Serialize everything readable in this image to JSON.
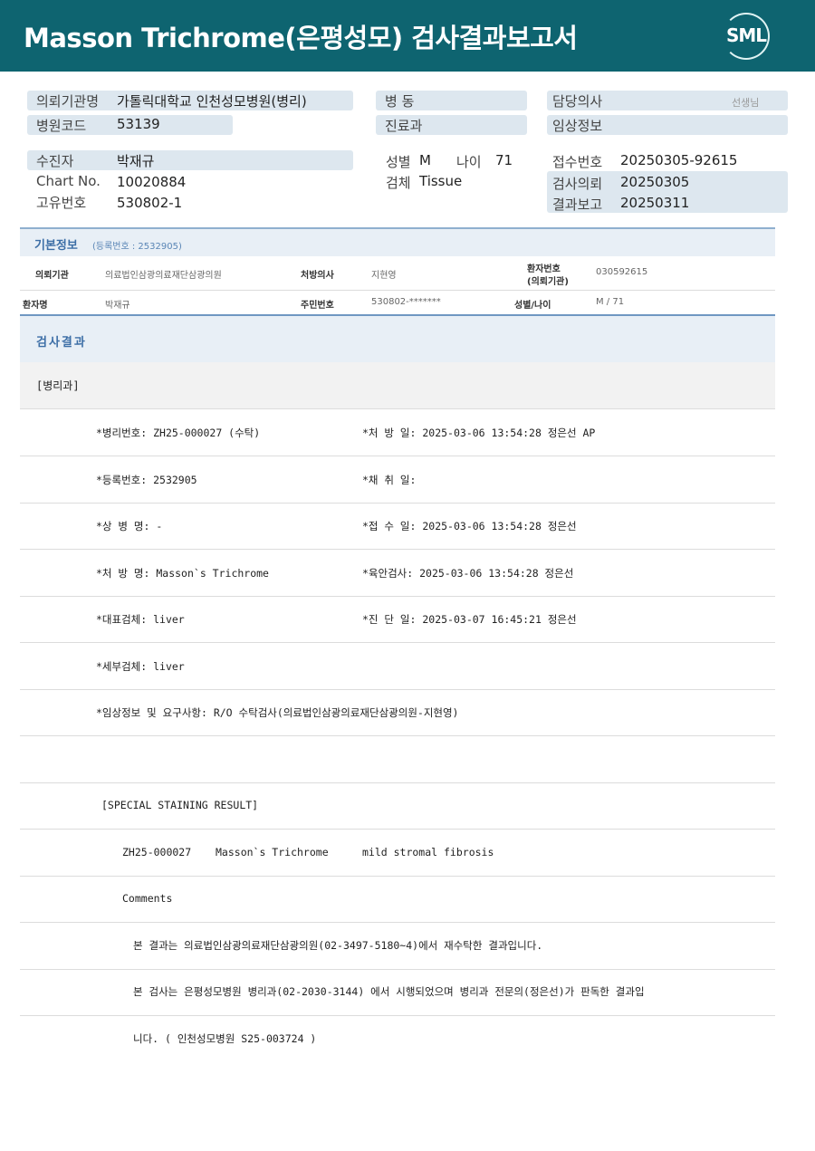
{
  "header": {
    "title": "Masson  Trichrome(은평성모) 검사결과보고서",
    "logo_text": "SML",
    "logo_icon": "sml-logo-icon",
    "bg_color": "#0e6470"
  },
  "patient_info": {
    "requester_label": "의뢰기관명",
    "requester_value": "가톨릭대학교 인천성모병원(병리)",
    "hospital_code_label": "병원코드",
    "hospital_code_value": "53139",
    "ward_label": "병  동",
    "ward_value": "",
    "dept_label": "진료과",
    "dept_value": "",
    "doctor_label": "담당의사",
    "doctor_suffix": "선생님",
    "clinical_label": "임상정보",
    "clinical_value": "",
    "patient_label": "수진자",
    "patient_value": "박재규",
    "chart_label": "Chart No.",
    "chart_value": "10020884",
    "unique_label": "고유번호",
    "unique_value": "530802-1",
    "sex_label": "성별",
    "sex_value": "M",
    "age_label": "나이",
    "age_value": "71",
    "specimen_label": "검체",
    "specimen_value": "Tissue",
    "receipt_label": "접수번호",
    "receipt_value": "20250305-92615",
    "request_label": "검사의뢰",
    "request_value": "20250305",
    "report_label": "결과보고",
    "report_value": "20250311"
  },
  "basic_info": {
    "title": "기본정보",
    "reg_no": "(등록번호 : 2532905)",
    "row1": {
      "l1": "의뢰기관",
      "v1": "의료법인삼광의료재단삼광의원",
      "l2": "처방의사",
      "v2": "지현영",
      "l3a": "환자번호",
      "l3b": "(의뢰기관)",
      "v3": "030592615"
    },
    "row2": {
      "l1": "환자명",
      "v1": "박재규",
      "l2": "주민번호",
      "v2": "530802-*******",
      "l3": "성별/나이",
      "v3": "M / 71"
    }
  },
  "results": {
    "title": "검사결과",
    "dept": "[병리과]",
    "rows": [
      {
        "left": "*병리번호: ZH25-000027 (수탁)",
        "right": "*처 방 일: 2025-03-06 13:54:28  정은선 AP"
      },
      {
        "left": "*등록번호: 2532905",
        "right": "*채 취 일:"
      },
      {
        "left": "*상 병 명: -",
        "right": "*접 수 일: 2025-03-06 13:54:28  정은선"
      },
      {
        "left": "*처 방 명: Masson`s Trichrome",
        "right": "*육안검사: 2025-03-06 13:54:28  정은선"
      },
      {
        "left": "*대표검체: liver",
        "right": "*진 단 일: 2025-03-07 16:45:21  정은선"
      },
      {
        "left": "*세부검체: liver",
        "right": ""
      },
      {
        "left": "*임상정보 및 요구사항: R/O 수탁검사(의료법인삼광의료재단삼광의원-지현영)",
        "right": ""
      }
    ],
    "special_title": "[SPECIAL STAINING RESULT]",
    "special_id": "ZH25-000027",
    "special_stain": "Masson`s Trichrome",
    "special_result": "mild stromal fibrosis",
    "comments_label": "Comments",
    "comment1": "본 결과는 의료법인삼광의료재단삼광의원(02-3497-5180~4)에서 재수탁한 결과입니다.",
    "comment2": "본 검사는 은평성모병원 병리과(02-2030-3144) 에서 시행되었으며 병리과 전문의(정은선)가 판독한 결과입",
    "comment3": "니다. ( 인천성모병원 S25-003724 )"
  }
}
